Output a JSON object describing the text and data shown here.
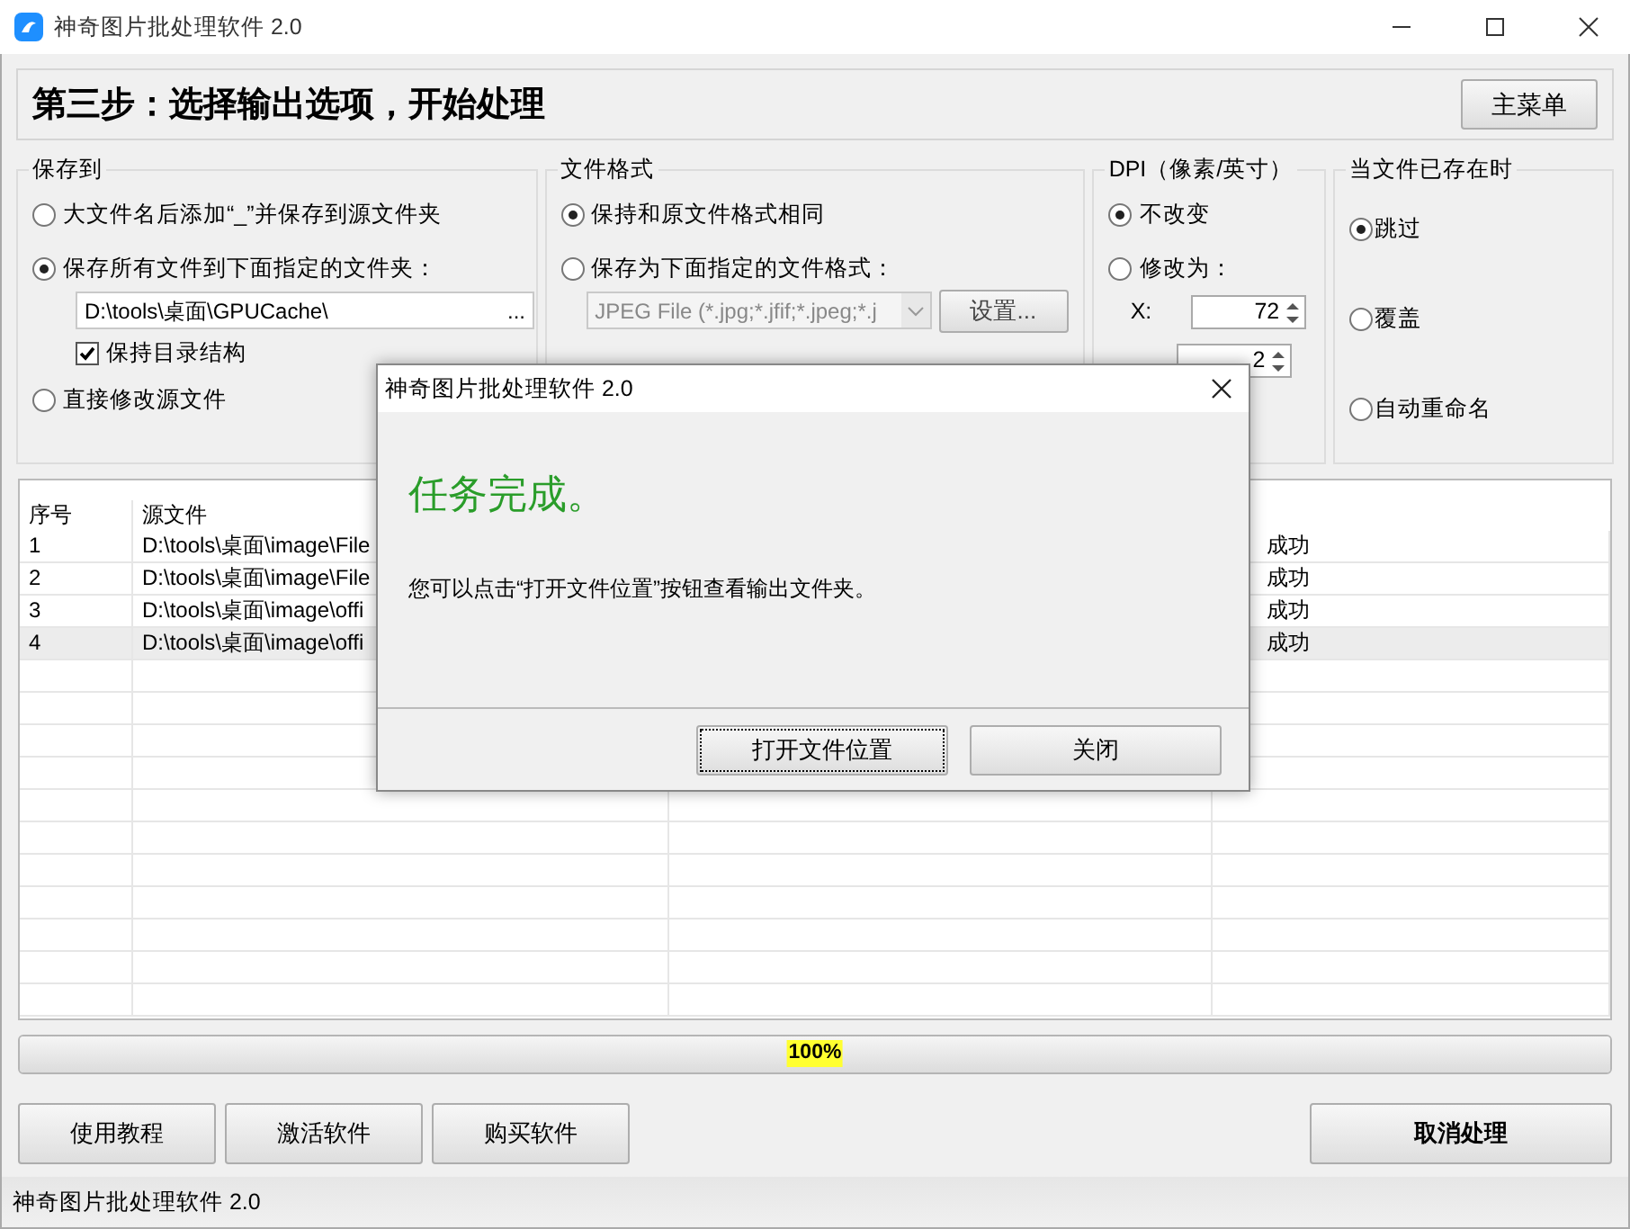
{
  "window": {
    "title": "神奇图片批处理软件 2.0"
  },
  "header": {
    "step_title": "第三步：选择输出选项，开始处理",
    "main_menu_button": "主菜单"
  },
  "save_to": {
    "title": "保存到",
    "options": [
      {
        "label": "大文件名后添加“_”并保存到源文件夹",
        "selected": false
      },
      {
        "label": "保存所有文件到下面指定的文件夹：",
        "selected": true
      },
      {
        "label": "直接修改源文件",
        "selected": false
      }
    ],
    "folder": "D:\\tools\\桌面\\GPUCache\\",
    "browse_button": "...",
    "keep_structure": {
      "label": "保持目录结构",
      "checked": true
    }
  },
  "file_format": {
    "title": "文件格式",
    "options": [
      {
        "label": "保持和原文件格式相同",
        "selected": true
      },
      {
        "label": "保存为下面指定的文件格式：",
        "selected": false
      }
    ],
    "format_select": "JPEG File (*.jpg;*.jfif;*.jpeg;*.j",
    "disabled": true,
    "settings_button": "设置..."
  },
  "dpi": {
    "title": "DPI（像素/英寸）",
    "options": [
      {
        "label": "不改变",
        "selected": true
      },
      {
        "label": "修改为：",
        "selected": false
      }
    ],
    "x_label": "X:",
    "x_value": "72",
    "y_value": "2"
  },
  "if_exists": {
    "title": "当文件已存在时",
    "options": [
      {
        "label": "跳过",
        "selected": true
      },
      {
        "label": "覆盖",
        "selected": false
      },
      {
        "label": "自动重命名",
        "selected": false
      }
    ]
  },
  "table": {
    "columns": [
      "序号",
      "源文件"
    ],
    "rows": [
      {
        "no": "1",
        "source": "D:\\tools\\桌面\\image\\File",
        "status": "成功",
        "selected": false
      },
      {
        "no": "2",
        "source": "D:\\tools\\桌面\\image\\File",
        "status": "成功",
        "selected": false
      },
      {
        "no": "3",
        "source": "D:\\tools\\桌面\\image\\offi",
        "status": "成功",
        "selected": false
      },
      {
        "no": "4",
        "source": "D:\\tools\\桌面\\image\\offi",
        "status": "成功",
        "selected": true
      }
    ]
  },
  "progress": {
    "level": 1,
    "label": "100%"
  },
  "buttons": [
    "使用教程",
    "激活软件",
    "购买软件"
  ],
  "cancel_button": "取消处理",
  "status_bar": "神奇图片批处理软件 2.0",
  "dialog": {
    "title": "神奇图片批处理软件 2.0",
    "heading": "任务完成。",
    "message": "您可以点击“打开文件位置”按钮查看输出文件夹。",
    "buttons": [
      {
        "label": "打开文件位置",
        "focused": true
      },
      {
        "label": "关闭",
        "focused": false
      }
    ]
  }
}
